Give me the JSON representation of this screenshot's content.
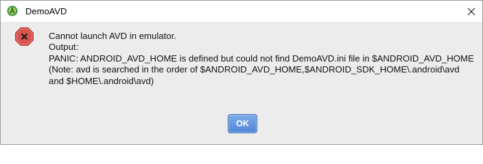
{
  "window": {
    "title": "DemoAVD",
    "close_glyph": "✕"
  },
  "dialog": {
    "icon": "error-octagon-icon",
    "lines": [
      "Cannot launch AVD in emulator.",
      "Output:",
      "PANIC: ANDROID_AVD_HOME is defined but could not find DemoAVD.ini file in $ANDROID_AVD_HOME",
      "(Note: avd is searched in the order of $ANDROID_AVD_HOME,$ANDROID_SDK_HOME\\.android\\avd",
      "and $HOME\\.android\\avd)"
    ],
    "ok_label": "OK"
  },
  "colors": {
    "error_red": "#d9534f",
    "accent_blue": "#4f85d8"
  }
}
